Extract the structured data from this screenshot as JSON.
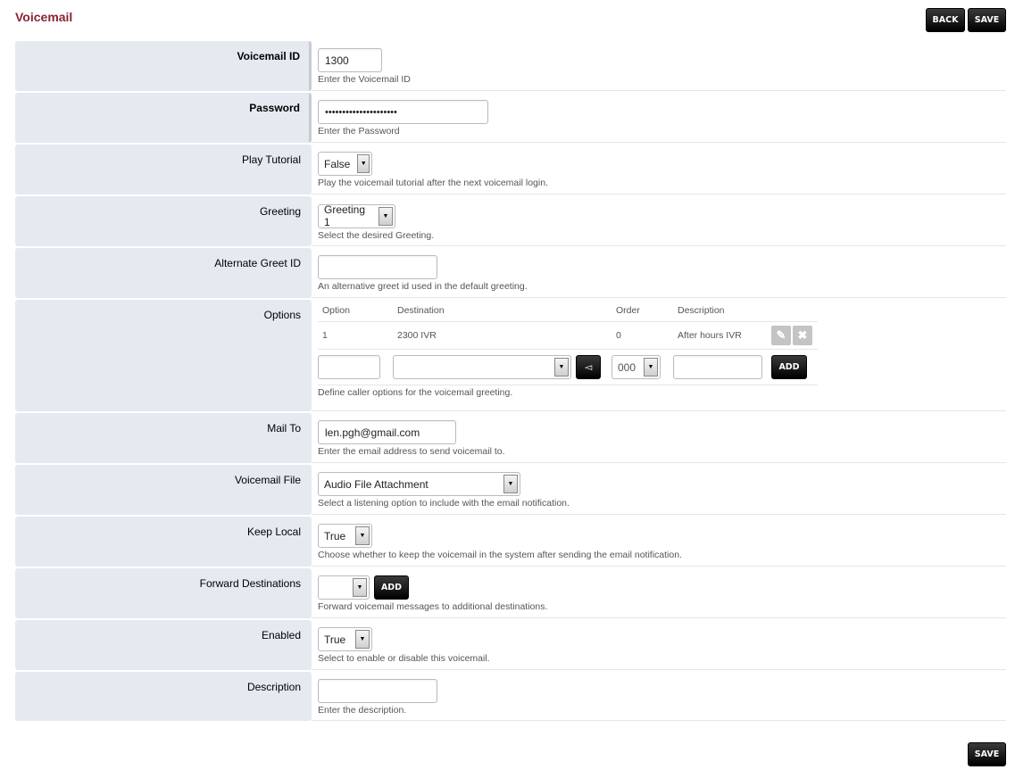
{
  "page": {
    "title": "Voicemail",
    "back_label": "BACK",
    "save_label": "SAVE"
  },
  "colors": {
    "title": "#8a2432",
    "label_bg": "#e5e9f0",
    "button_dark": "#000000"
  },
  "fields": {
    "voicemail_id": {
      "label": "Voicemail ID",
      "value": "1300",
      "desc": "Enter the Voicemail ID"
    },
    "password": {
      "label": "Password",
      "value": "•••••••••••••••••••••",
      "desc": "Enter the Password"
    },
    "play_tutorial": {
      "label": "Play Tutorial",
      "value": "False",
      "desc": "Play the voicemail tutorial after the next voicemail login."
    },
    "greeting": {
      "label": "Greeting",
      "value": "Greeting 1",
      "desc": "Select the desired Greeting."
    },
    "alternate_greet_id": {
      "label": "Alternate Greet ID",
      "value": "",
      "desc": "An alternative greet id used in the default greeting."
    },
    "options": {
      "label": "Options",
      "headers": [
        "Option",
        "Destination",
        "Order",
        "Description"
      ],
      "rows": [
        {
          "option": "1",
          "destination": "2300 IVR",
          "order": "0",
          "description": "After hours IVR"
        }
      ],
      "new_row": {
        "option": "",
        "destination": "",
        "order": "000",
        "description": "",
        "add_label": "ADD"
      },
      "desc": "Define caller options for the voicemail greeting."
    },
    "mail_to": {
      "label": "Mail To",
      "value": "len.pgh@gmail.com",
      "desc": "Enter the email address to send voicemail to."
    },
    "voicemail_file": {
      "label": "Voicemail File",
      "value": "Audio File Attachment",
      "desc": "Select a listening option to include with the email notification."
    },
    "keep_local": {
      "label": "Keep Local",
      "value": "True",
      "desc": "Choose whether to keep the voicemail in the system after sending the email notification."
    },
    "forward_destinations": {
      "label": "Forward Destinations",
      "value": "",
      "add_label": "ADD",
      "desc": "Forward voicemail messages to additional destinations."
    },
    "enabled": {
      "label": "Enabled",
      "value": "True",
      "desc": "Select to enable or disable this voicemail."
    },
    "description": {
      "label": "Description",
      "value": "",
      "desc": "Enter the description."
    }
  }
}
